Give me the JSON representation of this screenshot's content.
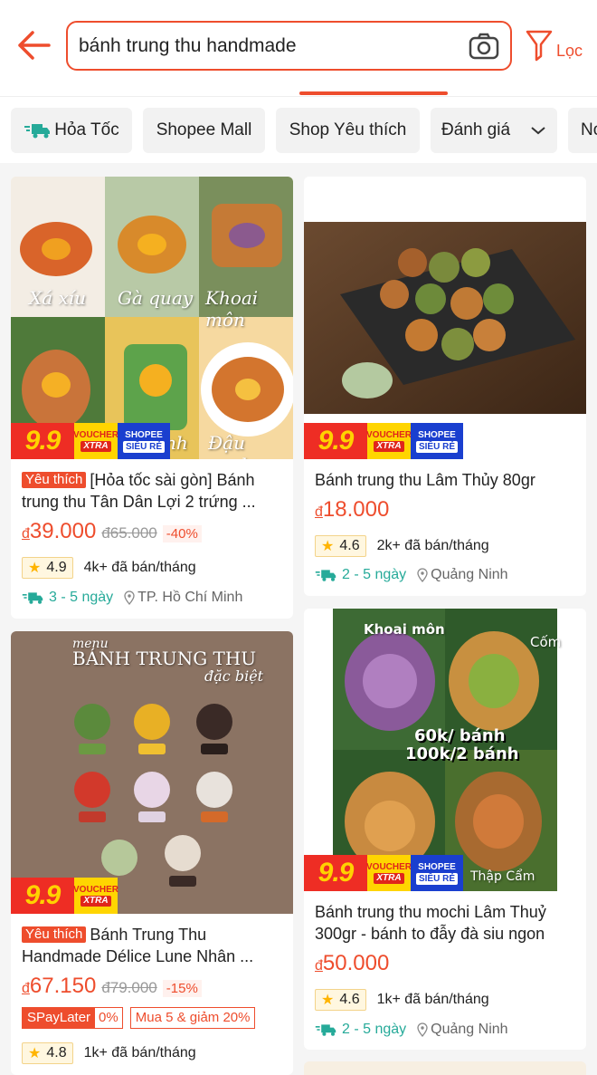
{
  "search": {
    "value": "bánh trung thu handmade"
  },
  "filter": {
    "label": "Lọc"
  },
  "chips": [
    "Hỏa Tốc",
    "Shopee Mall",
    "Shop Yêu thích",
    "Đánh giá",
    "No"
  ],
  "badges": {
    "nine": "9.9",
    "voucher": "VOUCHER",
    "xtra": "XTRA",
    "shopee": "SHOPEE",
    "sieu_re": "SIÊU RẺ"
  },
  "currency": "đ",
  "products": [
    {
      "tag": "Yêu thích",
      "title_line1": "[Hỏa tốc sài gòn] Bánh",
      "title_line2": "trung thu Tân Dân Lợi 2 trứng ...",
      "price": "39.000",
      "old_price": "đ65.000",
      "discount": "-40%",
      "rating": "4.9",
      "sold": "4k+ đã bán/tháng",
      "ship_days": "3 - 5 ngày",
      "location": "TP. Hồ Chí Minh",
      "image_labels": [
        "Xá xíu",
        "Gà quay",
        "Khoai môn",
        "nh",
        "Đậu xanh"
      ]
    },
    {
      "title_line1": "Bánh trung thu Lâm Thủy 80gr",
      "price": "18.000",
      "rating": "4.6",
      "sold": "2k+ đã bán/tháng",
      "ship_days": "2 - 5 ngày",
      "location": "Quảng Ninh"
    },
    {
      "tag": "Yêu thích",
      "title_line1": "Bánh Trung Thu",
      "title_line2": "Handmade Délice Lune Nhân ...",
      "price": "67.150",
      "old_price": "đ79.000",
      "discount": "-15%",
      "promo_a": "SPayLater",
      "promo_b": "0%",
      "promo_c": "Mua 5 & giảm 20%",
      "rating": "4.8",
      "sold": "1k+ đã bán/tháng",
      "image_labels": [
        "menu",
        "BÁNH TRUNG THU",
        "đặc biệt"
      ]
    },
    {
      "title_line1": "Bánh trung thu mochi Lâm Thuỷ",
      "title_line2": "300gr - bánh to đẫy đà siu ngon",
      "price": "50.000",
      "rating": "4.6",
      "sold": "1k+ đã bán/tháng",
      "ship_days": "2 - 5 ngày",
      "location": "Quảng Ninh",
      "image_labels": [
        "Khoai môn",
        "Cốm",
        "60k/ bánh",
        "100k/2 bánh",
        "Thập Cẩm"
      ]
    }
  ]
}
